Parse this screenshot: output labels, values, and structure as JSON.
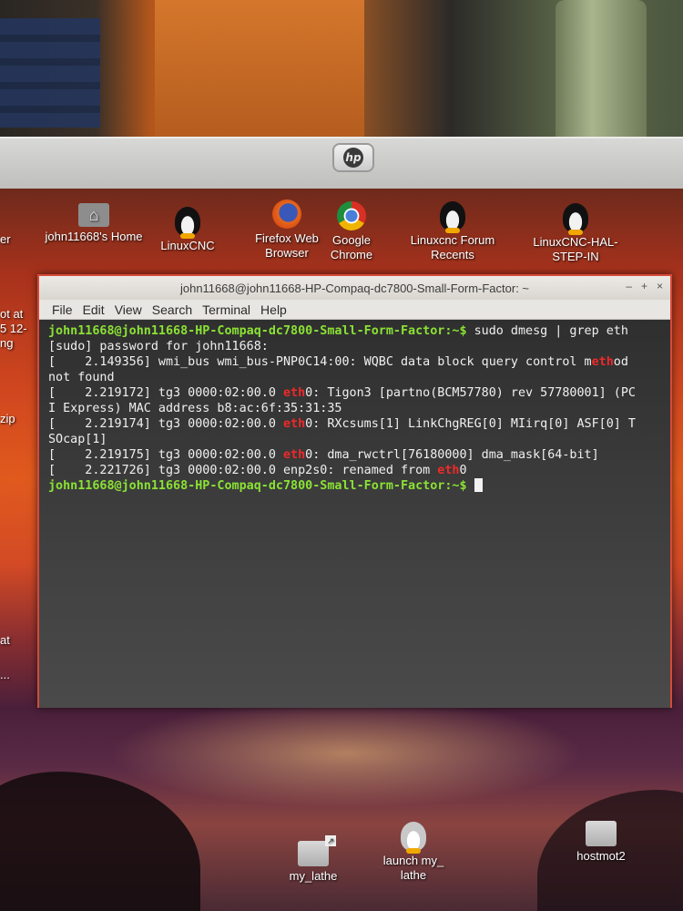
{
  "hardware": {
    "brand_logo": "hp"
  },
  "desktop": {
    "icons_top": [
      {
        "label": "john11668's Home",
        "icon": "home-folder-icon"
      },
      {
        "label": "LinuxCNC",
        "icon": "tux-icon"
      },
      {
        "label": "Firefox Web Browser",
        "icon": "firefox-icon"
      },
      {
        "label": "Google Chrome",
        "icon": "chrome-icon"
      },
      {
        "label": "Linuxcnc Forum Recents",
        "icon": "tux-icon"
      },
      {
        "label": "LinuxCNC-HAL-STEP-IN",
        "icon": "tux-icon"
      }
    ],
    "icons_bottom": [
      {
        "label": "my_lathe",
        "icon": "folder-link-icon"
      },
      {
        "label": "launch my_ lathe",
        "icon": "tux-light-icon"
      },
      {
        "label": "hostmot2",
        "icon": "folder-icon"
      }
    ],
    "edge_fragments": [
      "er",
      "ot at",
      "5 12-",
      "ng",
      "zip",
      "at",
      "..."
    ]
  },
  "terminal": {
    "title": "john11668@john11668-HP-Compaq-dc7800-Small-Form-Factor: ~",
    "menu": [
      "File",
      "Edit",
      "View",
      "Search",
      "Terminal",
      "Help"
    ],
    "prompt": "john11668@john11668-HP-Compaq-dc7800-Small-Form-Factor:~$",
    "command": " sudo dmesg | grep eth",
    "lines": {
      "l1": "[sudo] password for john11668:",
      "l2a": "[    2.149356] wmi_bus wmi_bus-PNP0C14:00: WQBC data block query control m",
      "l2b": "eth",
      "l2c": "od",
      "l3": "not found",
      "l4a": "[    2.219172] tg3 0000:02:00.0 ",
      "l4b": "eth",
      "l4c": "0: Tigon3 [partno(BCM57780) rev 57780001] (PC",
      "l5": "I Express) MAC address b8:ac:6f:35:31:35",
      "l6a": "[    2.219174] tg3 0000:02:00.0 ",
      "l6b": "eth",
      "l6c": "0: RXcsums[1] LinkChgREG[0] MIirq[0] ASF[0] T",
      "l7": "SOcap[1]",
      "l8a": "[    2.219175] tg3 0000:02:00.0 ",
      "l8b": "eth",
      "l8c": "0: dma_rwctrl[76180000] dma_mask[64-bit]",
      "l9a": "[    2.221726] tg3 0000:02:00.0 enp2s0: renamed from ",
      "l9b": "eth",
      "l9c": "0"
    }
  }
}
